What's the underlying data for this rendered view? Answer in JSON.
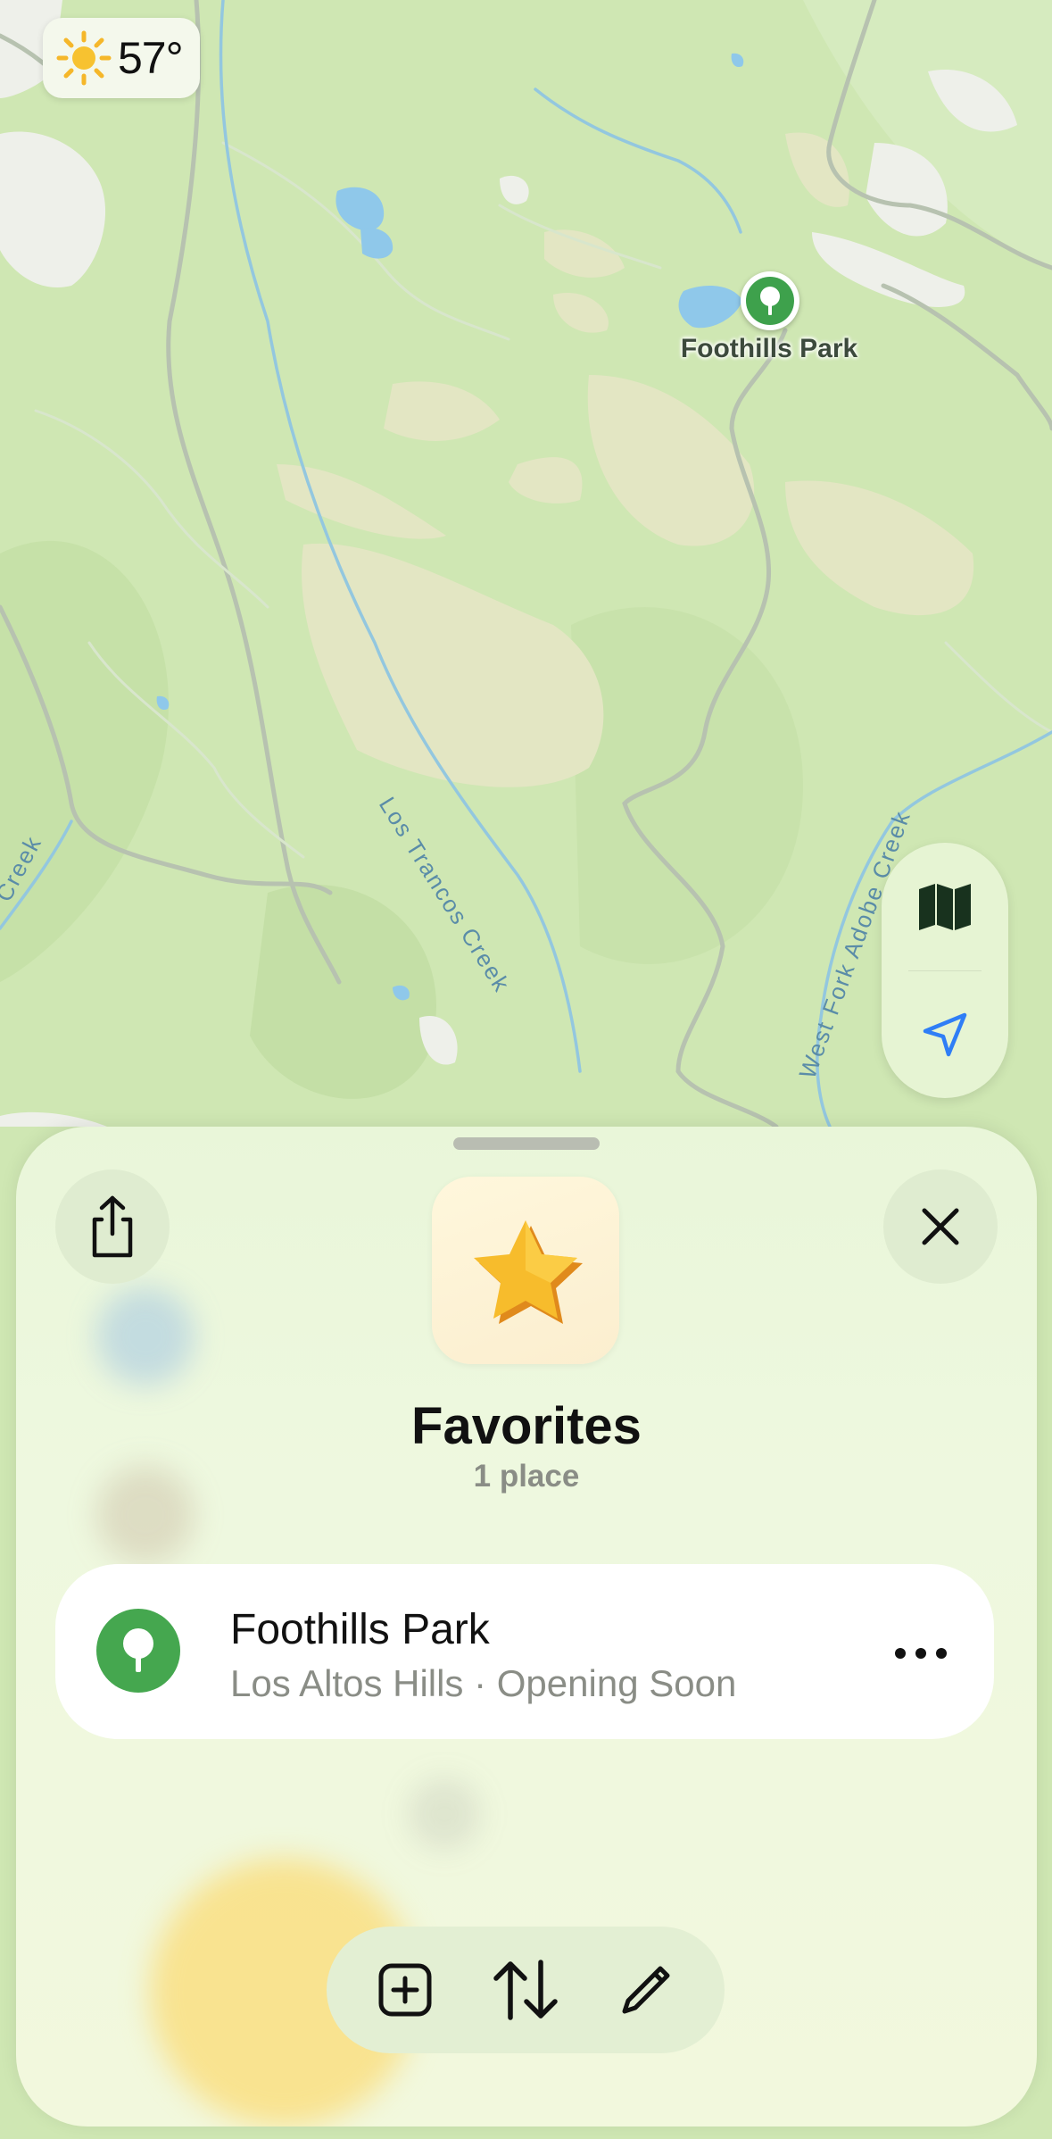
{
  "status": {
    "weather_temp": "57°",
    "weather_icon": "sun-icon"
  },
  "map": {
    "poi": {
      "name": "Foothills Park",
      "icon": "tree-icon"
    },
    "labels": {
      "creek1": "Los Trancos Creek",
      "creek2": "West Fork Adobe Creek",
      "creek3": "Creek"
    },
    "controls": [
      "map-mode-icon",
      "location-arrow-icon"
    ],
    "colors": {
      "land": "#cfe7b3",
      "hills": "#e5e8c6",
      "water": "#8fc8ea",
      "roads": "#b8c4b2"
    }
  },
  "sheet": {
    "title": "Favorites",
    "subtitle": "1 place",
    "list_icon": "star-icon",
    "buttons": {
      "share": "share-icon",
      "close": "close-icon"
    },
    "places": [
      {
        "name": "Foothills Park",
        "detail": "Los Altos Hills · Opening Soon",
        "icon": "tree-icon"
      }
    ],
    "toolbar": [
      "add-square-icon",
      "sort-arrows-icon",
      "pencil-icon"
    ],
    "colors": {
      "accent_green": "#45a74f",
      "star_yellow": "#f5b72a"
    }
  }
}
